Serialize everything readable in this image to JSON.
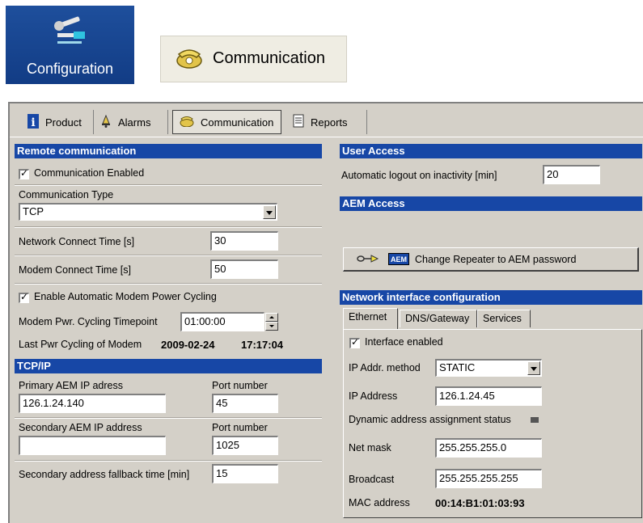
{
  "top_icons": {
    "configuration_label": "Configuration",
    "communication_label": "Communication"
  },
  "tabs": [
    {
      "label": "Product",
      "icon": "info-icon"
    },
    {
      "label": "Alarms",
      "icon": "bell-icon"
    },
    {
      "label": "Communication",
      "icon": "phone-icon",
      "active": true
    },
    {
      "label": "Reports",
      "icon": "report-icon"
    }
  ],
  "remote": {
    "header": "Remote communication",
    "comm_enabled_label": "Communication Enabled",
    "comm_type_label": "Communication Type",
    "comm_type_value": "TCP",
    "network_connect_label": "Network Connect Time [s]",
    "network_connect_value": "30",
    "modem_connect_label": "Modem Connect Time [s]",
    "modem_connect_value": "50",
    "auto_cycle_label": "Enable Automatic Modem Power Cycling",
    "timepoint_label": "Modem Pwr. Cycling Timepoint",
    "timepoint_value": "01:00:00",
    "last_cycle_label": "Last Pwr Cycling of Modem",
    "last_cycle_date": "2009-02-24",
    "last_cycle_time": "17:17:04"
  },
  "tcpip": {
    "header": "TCP/IP",
    "primary_label": "Primary AEM IP adress",
    "primary_value": "126.1.24.140",
    "port_label_1": "Port number",
    "port_value_1": "45",
    "secondary_label": "Secondary AEM IP address",
    "secondary_value": "",
    "port_label_2": "Port number",
    "port_value_2": "1025",
    "fallback_label": "Secondary address fallback time [min]",
    "fallback_value": "15"
  },
  "user_access": {
    "header": "User Access",
    "logout_label": "Automatic logout on inactivity [min]",
    "logout_value": "20"
  },
  "aem_access": {
    "header": "AEM Access",
    "button_label": "Change Repeater to AEM password",
    "button_badge": "AEM"
  },
  "network": {
    "header": "Network interface configuration",
    "subtabs": [
      "Ethernet",
      "DNS/Gateway",
      "Services"
    ],
    "interface_enabled_label": "Interface enabled",
    "ip_method_label": "IP Addr. method",
    "ip_method_value": "STATIC",
    "ip_address_label": "IP Address",
    "ip_address_value": "126.1.24.45",
    "dynamic_status_label": "Dynamic address assignment status",
    "netmask_label": "Net mask",
    "netmask_value": "255.255.255.0",
    "broadcast_label": "Broadcast",
    "broadcast_value": "255.255.255.255",
    "mac_label": "MAC address",
    "mac_value": "00:14:B1:01:03:93"
  }
}
